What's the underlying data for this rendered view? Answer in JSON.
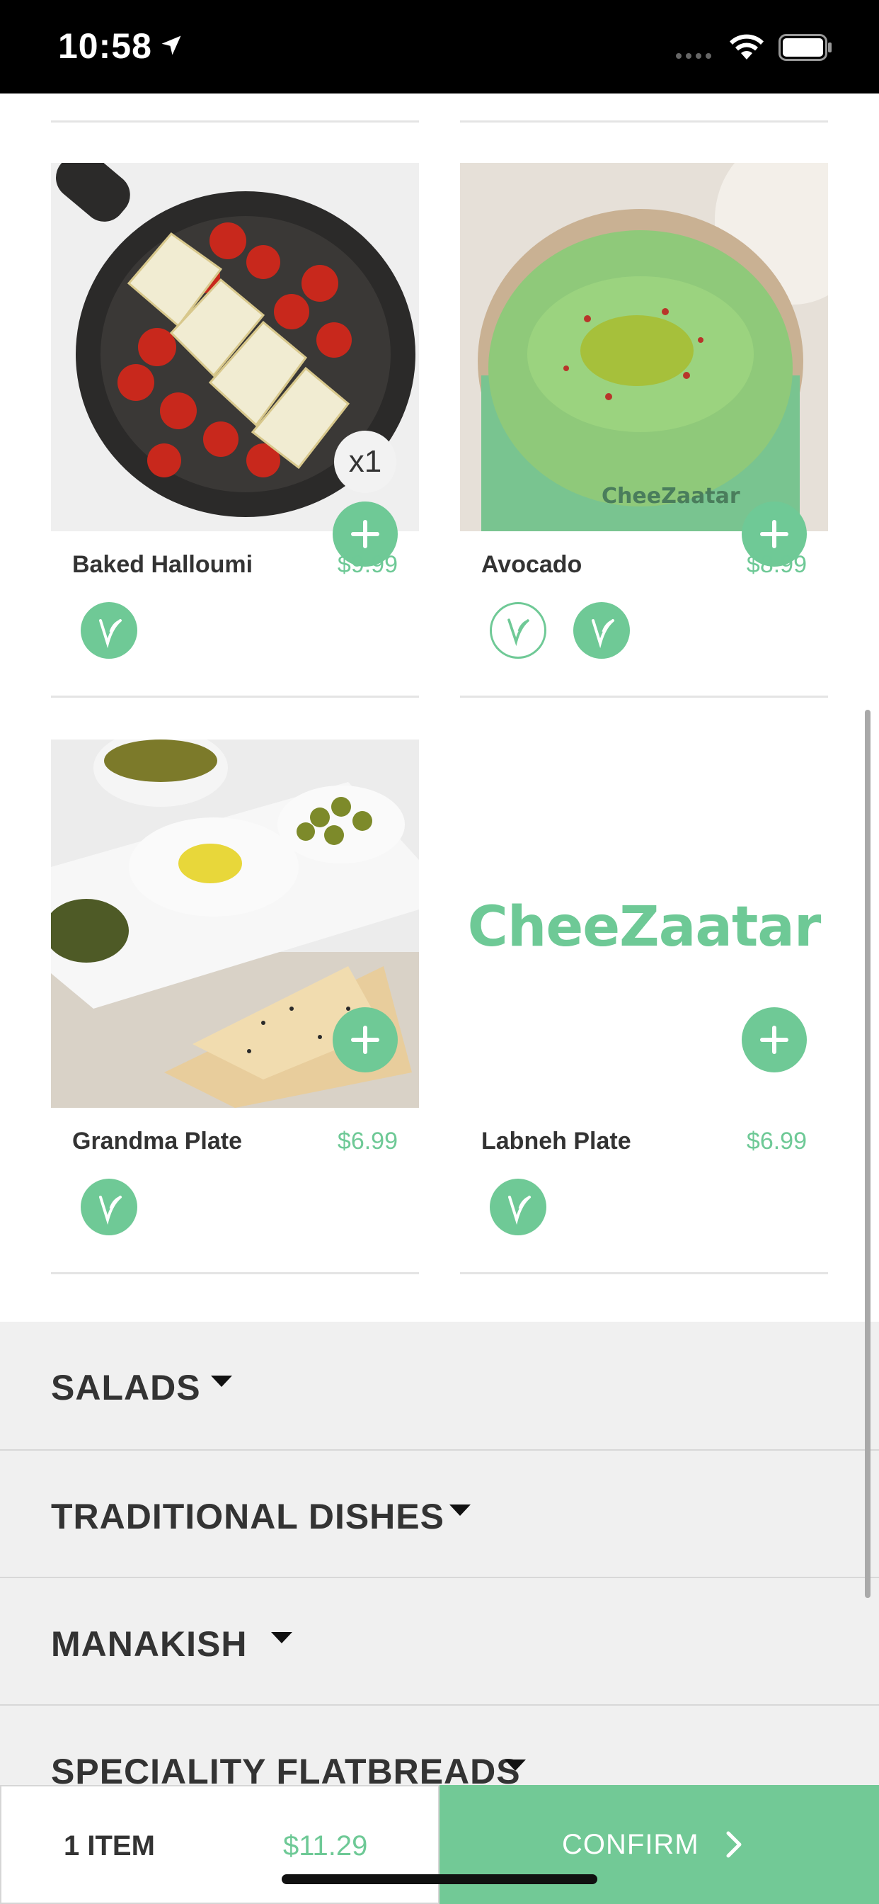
{
  "status_bar": {
    "time": "10:58",
    "icons": [
      "location-arrow-icon",
      "signal-icon",
      "wifi-icon",
      "battery-icon"
    ]
  },
  "products": [
    {
      "name": "Baked Halloumi",
      "price": "$9.99",
      "quantity_badge": "x1",
      "image": "halloumi-skillet",
      "diet_icons": [
        "vegetarian-filled"
      ]
    },
    {
      "name": "Avocado",
      "price": "$8.99",
      "image": "avocado-dip",
      "diet_icons": [
        "vegan-outline",
        "vegetarian-filled"
      ]
    },
    {
      "name": "Grandma Plate",
      "price": "$6.99",
      "image": "grandma-plate",
      "diet_icons": [
        "vegetarian-filled"
      ]
    },
    {
      "name": "Labneh Plate",
      "price": "$6.99",
      "image_placeholder_logo": "CheeZaatar",
      "diet_icons": [
        "vegetarian-filled"
      ]
    }
  ],
  "categories": [
    {
      "label": "SALADS"
    },
    {
      "label": "TRADITIONAL DISHES"
    },
    {
      "label": "MANAKISH"
    },
    {
      "label": "SPECIALITY FLATBREADS"
    }
  ],
  "cart": {
    "item_count": "1 ITEM",
    "total": "$11.29",
    "confirm_label": "CONFIRM"
  },
  "colors": {
    "accent": "#6fc996",
    "category_bg": "#f0f0f0",
    "text": "#333333"
  }
}
